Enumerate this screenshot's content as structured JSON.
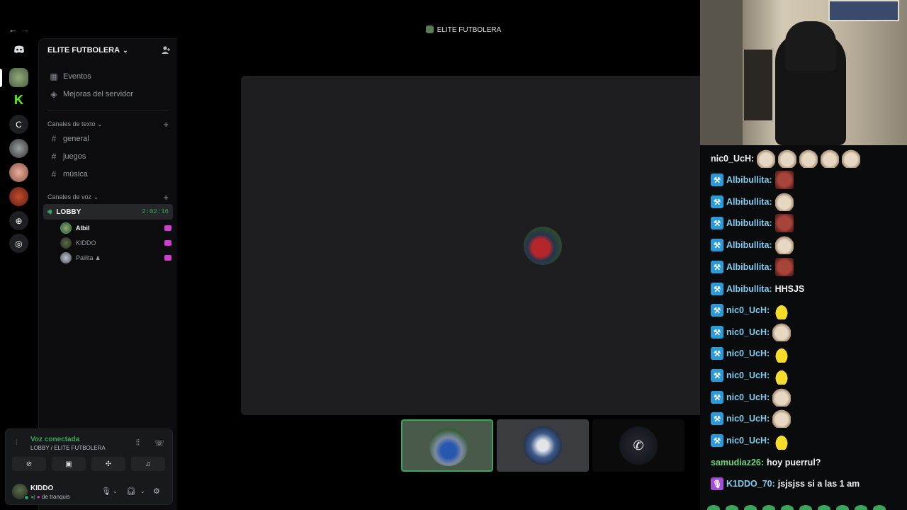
{
  "window": {
    "title": "ELITE FUTBOLERA"
  },
  "server": {
    "name": "ELITE FUTBOLERA"
  },
  "sidebar": {
    "top_items": [
      {
        "label": "Eventos",
        "icon": "calendar-icon"
      },
      {
        "label": "Mejoras del servidor",
        "icon": "boost-icon"
      }
    ],
    "text_category": "Canales de texto",
    "text_channels": [
      "general",
      "juegos",
      "música"
    ],
    "voice_category": "Canales de voz",
    "voice_channel": {
      "name": "LOBBY",
      "timer": "2:02:16"
    },
    "voice_members": [
      "Albil",
      "KIDDO",
      "Pailita"
    ]
  },
  "rail": {
    "letter_server": "C"
  },
  "voice_panel": {
    "status": "Voz conectada",
    "location": "LOBBY / ELITE FUTBOLERA"
  },
  "user": {
    "name": "KIDDO",
    "status": "de tranquis"
  },
  "chat": {
    "messages": [
      {
        "user": "nic0_UcH:",
        "emotes": [
          "cat",
          "cat",
          "cat",
          "cat",
          "cat"
        ]
      },
      {
        "user": "Albibullita:",
        "emotes": [
          "face"
        ]
      },
      {
        "user": "Albibullita:",
        "emotes": [
          "cat"
        ]
      },
      {
        "user": "Albibullita:",
        "emotes": [
          "face"
        ]
      },
      {
        "user": "Albibullita:",
        "emotes": [
          "cat"
        ]
      },
      {
        "user": "Albibullita:",
        "emotes": [
          "face"
        ]
      },
      {
        "user": "Albibullita:",
        "text": "HHSJS"
      },
      {
        "user": "nic0_UcH:",
        "emotes": [
          "duck"
        ]
      },
      {
        "user": "nic0_UcH:",
        "emotes": [
          "cat"
        ]
      },
      {
        "user": "nic0_UcH:",
        "emotes": [
          "duck"
        ]
      },
      {
        "user": "nic0_UcH:",
        "emotes": [
          "duck"
        ]
      },
      {
        "user": "nic0_UcH:",
        "emotes": [
          "cat"
        ]
      },
      {
        "user": "nic0_UcH:",
        "emotes": [
          "cat"
        ]
      },
      {
        "user": "nic0_UcH:",
        "emotes": [
          "duck"
        ]
      },
      {
        "user": "samudiaz26:",
        "text": "hoy puerrul?"
      },
      {
        "user": "K1DDO_70:",
        "text": "jsjsjss si a las 1 am"
      }
    ]
  },
  "colors": {
    "accent_green": "#3ba55d",
    "live_pink": "#d23cd0",
    "chat_user_blue": "#7ecdf0"
  }
}
